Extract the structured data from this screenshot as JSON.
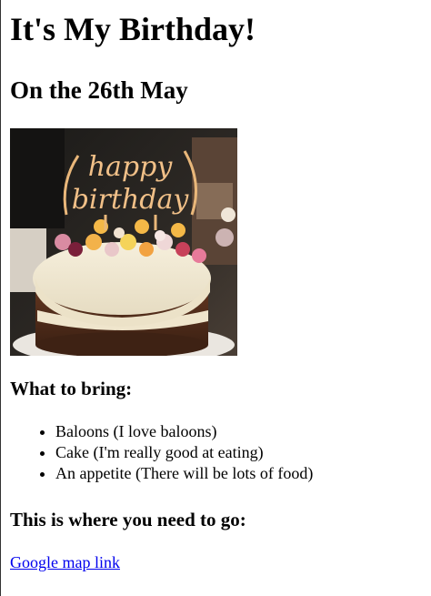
{
  "heading": "It's My Birthday!",
  "subheading": "On the 26th May",
  "image": {
    "topper_line1": "happy",
    "topper_line2": "birthday"
  },
  "bring_heading": "What to bring:",
  "bring_items": [
    "Baloons (I love baloons)",
    "Cake (I'm really good at eating)",
    "An appetite (There will be lots of food)"
  ],
  "go_heading": "This is where you need to go:",
  "map_link": "Google map link"
}
